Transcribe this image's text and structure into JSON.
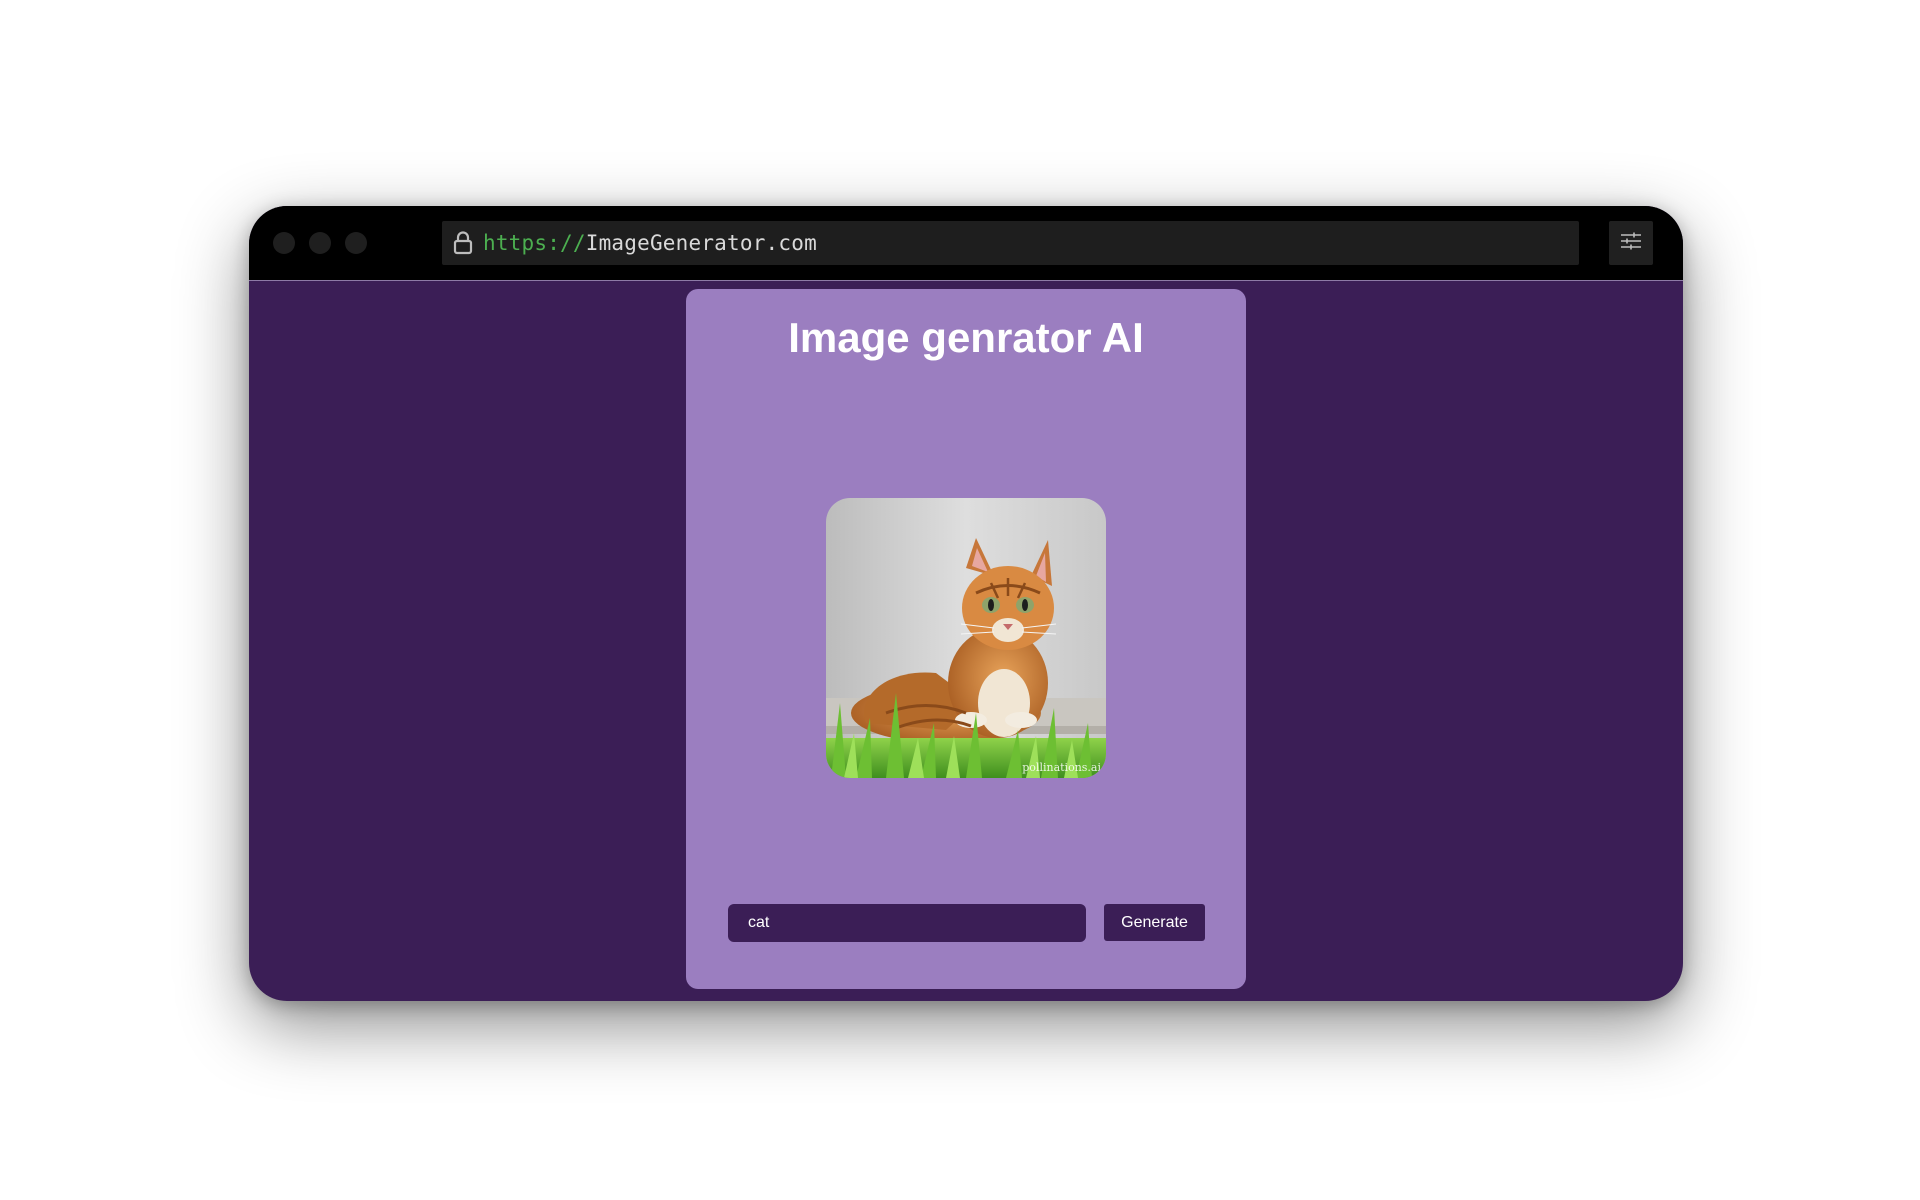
{
  "browser": {
    "url_protocol": "https://",
    "url_host": "ImageGenerator.com"
  },
  "app": {
    "title": "Image genrator AI",
    "image_watermark": "pollinations.ai",
    "prompt_value": "cat",
    "generate_label": "Generate"
  },
  "colors": {
    "page_background": "#3b1e56",
    "card_background": "#9b7ec0",
    "titlebar": "#000000",
    "url_protocol": "#4caf50"
  },
  "icons": {
    "lock": "lock-icon",
    "settings": "sliders-icon"
  }
}
